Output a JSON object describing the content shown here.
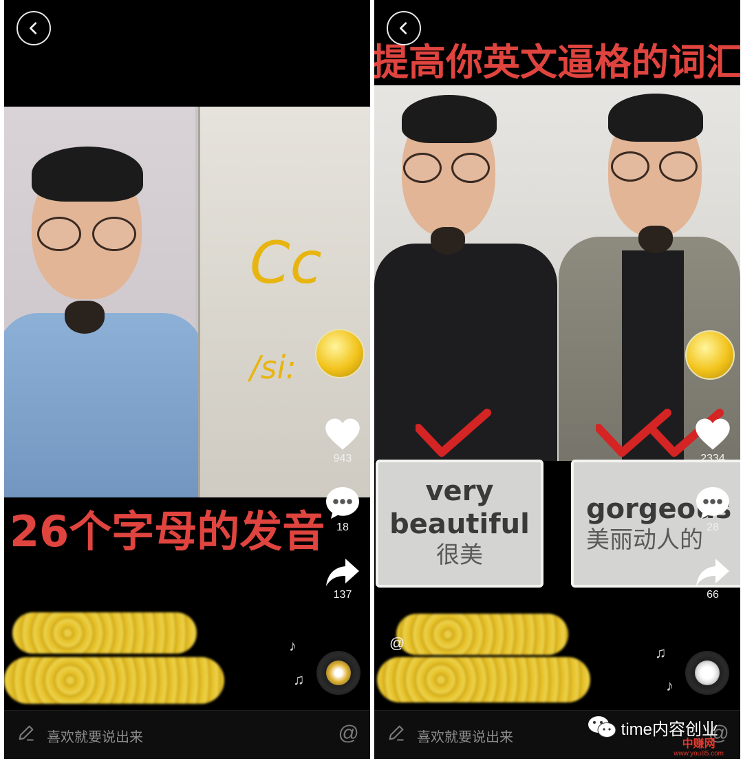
{
  "left": {
    "video_text": {
      "letter": "Cc",
      "phonetic": "/si:",
      "subtitle": "26个字母的发音"
    },
    "actions": {
      "likes": "943",
      "comments": "18",
      "shares": "137"
    },
    "comment_placeholder": "喜欢就要说出来",
    "at_symbol": "@"
  },
  "right": {
    "video_text": {
      "title_banner": "提高你英文逼格的词汇",
      "card_left_en_1": "very",
      "card_left_en_2": "beautiful",
      "card_left_zh": "很美",
      "card_right_en": "gorgeous",
      "card_right_zh": "美丽动人的"
    },
    "actions": {
      "likes": "2334",
      "comments": "28",
      "shares": "66"
    },
    "mention_prefix": "@",
    "comment_placeholder": "喜欢就要说出来",
    "at_symbol": "@"
  },
  "watermark": {
    "text": "time内容创业",
    "site_name": "中赚网",
    "site_url": "www.you85.com"
  },
  "colors": {
    "subtitle_red": "#e0443f",
    "letter_yellow": "#e8b510",
    "check_red": "#d42424"
  }
}
